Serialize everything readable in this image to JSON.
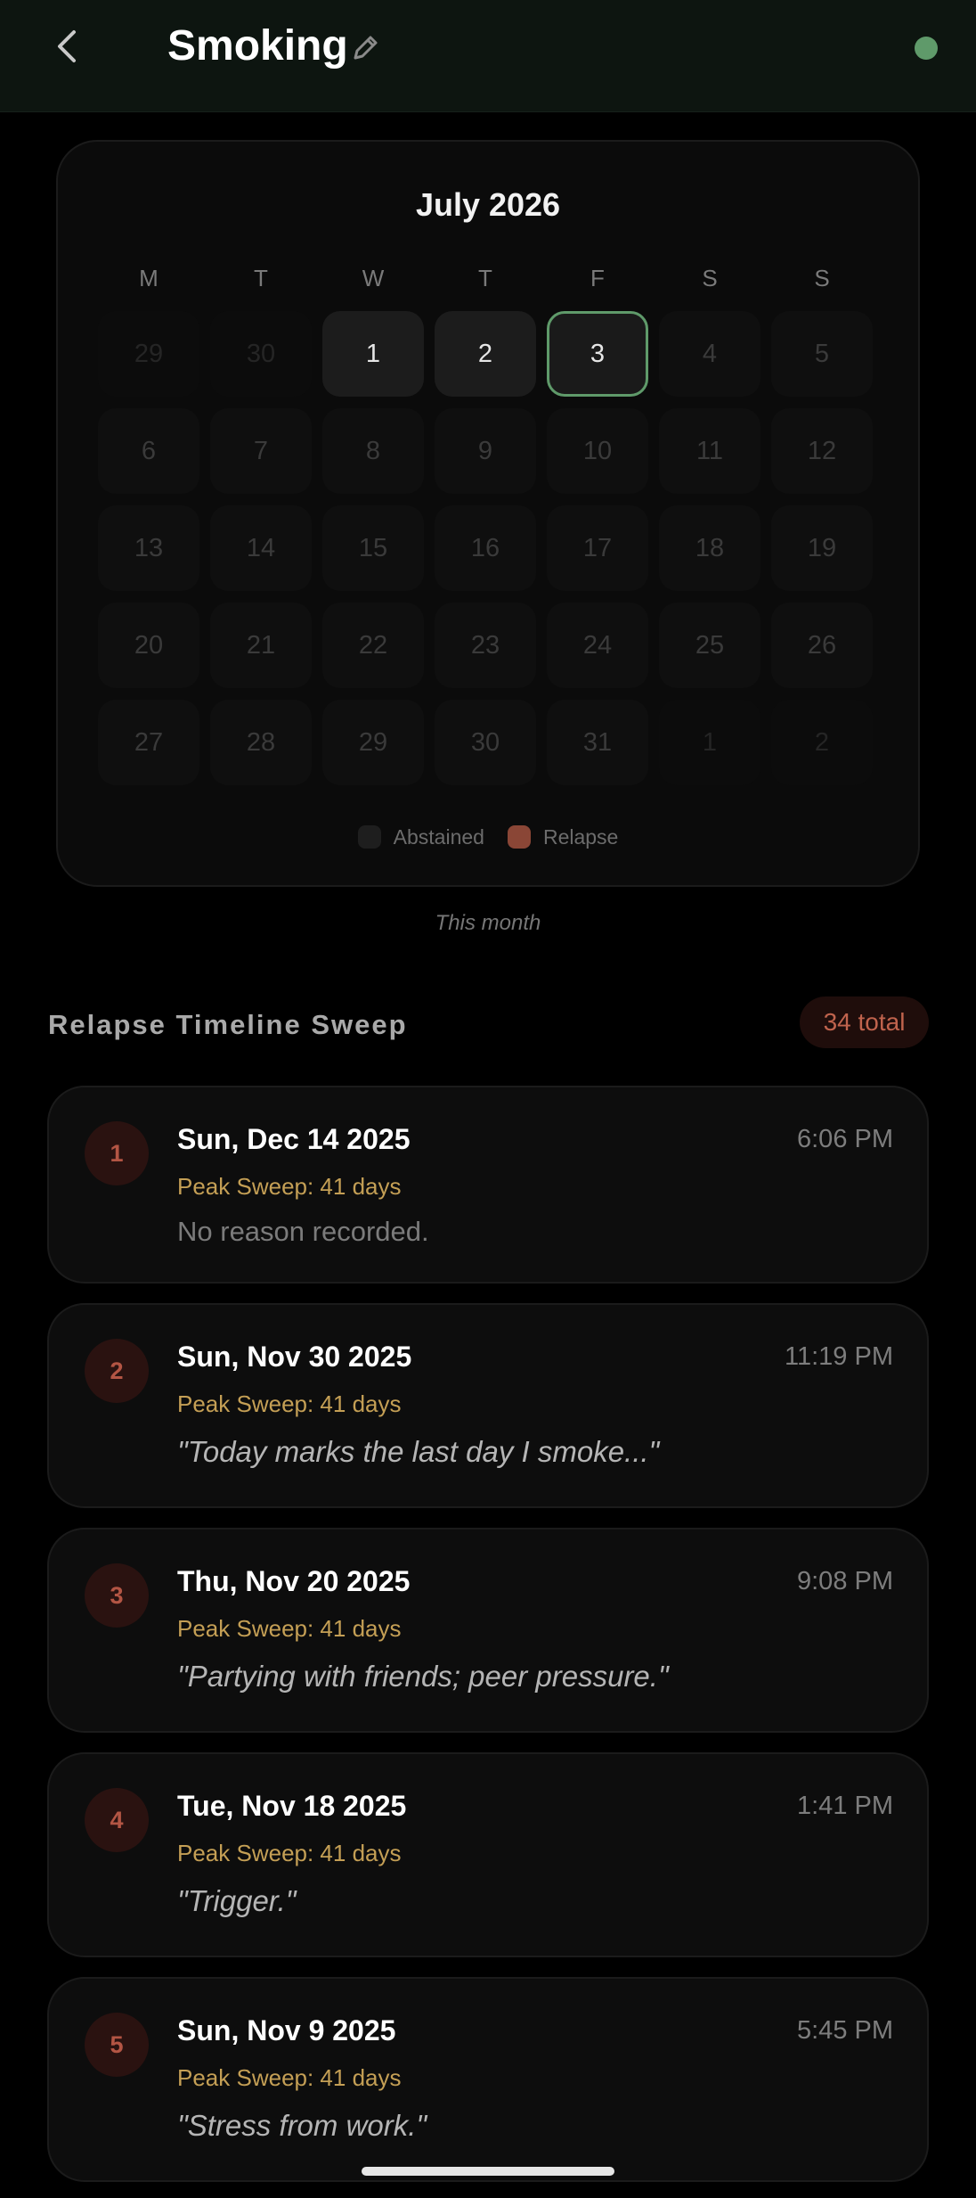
{
  "header": {
    "title": "Smoking",
    "back_icon": "chevron-left-icon",
    "edit_icon": "pencil-icon",
    "status_color": "#5f9a6a"
  },
  "calendar": {
    "month_label": "July 2026",
    "weekdays": [
      "M",
      "T",
      "W",
      "T",
      "F",
      "S",
      "S"
    ],
    "days": [
      {
        "label": "29",
        "state": "out"
      },
      {
        "label": "30",
        "state": "out"
      },
      {
        "label": "1",
        "state": "past"
      },
      {
        "label": "2",
        "state": "past"
      },
      {
        "label": "3",
        "state": "today"
      },
      {
        "label": "4",
        "state": "future"
      },
      {
        "label": "5",
        "state": "future"
      },
      {
        "label": "6",
        "state": "future"
      },
      {
        "label": "7",
        "state": "future"
      },
      {
        "label": "8",
        "state": "future"
      },
      {
        "label": "9",
        "state": "future"
      },
      {
        "label": "10",
        "state": "future"
      },
      {
        "label": "11",
        "state": "future"
      },
      {
        "label": "12",
        "state": "future"
      },
      {
        "label": "13",
        "state": "future"
      },
      {
        "label": "14",
        "state": "future"
      },
      {
        "label": "15",
        "state": "future"
      },
      {
        "label": "16",
        "state": "future"
      },
      {
        "label": "17",
        "state": "future"
      },
      {
        "label": "18",
        "state": "future"
      },
      {
        "label": "19",
        "state": "future"
      },
      {
        "label": "20",
        "state": "future"
      },
      {
        "label": "21",
        "state": "future"
      },
      {
        "label": "22",
        "state": "future"
      },
      {
        "label": "23",
        "state": "future"
      },
      {
        "label": "24",
        "state": "future"
      },
      {
        "label": "25",
        "state": "future"
      },
      {
        "label": "26",
        "state": "future"
      },
      {
        "label": "27",
        "state": "future"
      },
      {
        "label": "28",
        "state": "future"
      },
      {
        "label": "29",
        "state": "future"
      },
      {
        "label": "30",
        "state": "future"
      },
      {
        "label": "31",
        "state": "future"
      },
      {
        "label": "1",
        "state": "out"
      },
      {
        "label": "2",
        "state": "out"
      }
    ],
    "legend": {
      "abstained": "Abstained",
      "relapse": "Relapse",
      "abstained_color": "#1e1e1e",
      "relapse_color": "#8a4636"
    },
    "caption": "This month"
  },
  "timeline": {
    "title": "Relapse Timeline Sweep",
    "total_badge": "34 total",
    "entries": [
      {
        "number": "1",
        "date": "Sun, Dec 14 2025",
        "time": "6:06 PM",
        "peak": "Peak Sweep: 41 days",
        "reason": "No reason recorded."
      },
      {
        "number": "2",
        "date": "Sun, Nov 30 2025",
        "time": "11:19 PM",
        "peak": "Peak Sweep: 41 days",
        "reason": "\"Today marks the last day I smoke...\""
      },
      {
        "number": "3",
        "date": "Thu, Nov 20 2025",
        "time": "9:08 PM",
        "peak": "Peak Sweep: 41 days",
        "reason": "\"Partying with friends; peer pressure.\""
      },
      {
        "number": "4",
        "date": "Tue, Nov 18 2025",
        "time": "1:41 PM",
        "peak": "Peak Sweep: 41 days",
        "reason": "\"Trigger.\""
      },
      {
        "number": "5",
        "date": "Sun, Nov 9 2025",
        "time": "5:45 PM",
        "peak": "Peak Sweep: 41 days",
        "reason": "\"Stress from work.\""
      }
    ]
  }
}
